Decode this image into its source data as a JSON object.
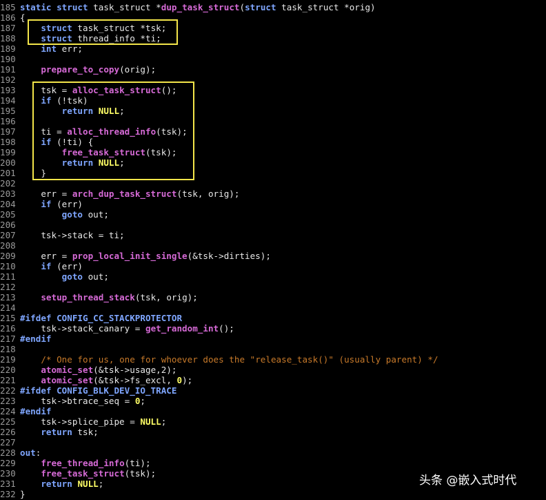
{
  "editor": {
    "lines": [
      {
        "n": "185",
        "tokens": [
          {
            "t": "static",
            "c": "kw"
          },
          {
            "t": " "
          },
          {
            "t": "struct",
            "c": "kw"
          },
          {
            "t": " task_struct *"
          },
          {
            "t": "dup_task_struct",
            "c": "fn"
          },
          {
            "t": "("
          },
          {
            "t": "struct",
            "c": "kw"
          },
          {
            "t": " task_struct *orig)"
          }
        ]
      },
      {
        "n": "186",
        "tokens": [
          {
            "t": "{"
          }
        ]
      },
      {
        "n": "187",
        "tokens": [
          {
            "t": "    "
          },
          {
            "t": "struct",
            "c": "kw"
          },
          {
            "t": " task_struct *tsk;"
          }
        ]
      },
      {
        "n": "188",
        "tokens": [
          {
            "t": "    "
          },
          {
            "t": "struct",
            "c": "kw"
          },
          {
            "t": " thread_info *ti;"
          }
        ]
      },
      {
        "n": "189",
        "tokens": [
          {
            "t": "    "
          },
          {
            "t": "int",
            "c": "kw"
          },
          {
            "t": " err;"
          }
        ]
      },
      {
        "n": "190",
        "tokens": []
      },
      {
        "n": "191",
        "tokens": [
          {
            "t": "    "
          },
          {
            "t": "prepare_to_copy",
            "c": "fn"
          },
          {
            "t": "(orig);"
          }
        ]
      },
      {
        "n": "192",
        "tokens": []
      },
      {
        "n": "193",
        "tokens": [
          {
            "t": "    tsk = "
          },
          {
            "t": "alloc_task_struct",
            "c": "fn"
          },
          {
            "t": "();"
          }
        ]
      },
      {
        "n": "194",
        "tokens": [
          {
            "t": "    "
          },
          {
            "t": "if",
            "c": "kw"
          },
          {
            "t": " (!tsk)"
          }
        ]
      },
      {
        "n": "195",
        "tokens": [
          {
            "t": "        "
          },
          {
            "t": "return",
            "c": "kw"
          },
          {
            "t": " "
          },
          {
            "t": "NULL",
            "c": "ct"
          },
          {
            "t": ";"
          }
        ]
      },
      {
        "n": "196",
        "tokens": []
      },
      {
        "n": "197",
        "tokens": [
          {
            "t": "    ti = "
          },
          {
            "t": "alloc_thread_info",
            "c": "fn"
          },
          {
            "t": "(tsk);"
          }
        ]
      },
      {
        "n": "198",
        "tokens": [
          {
            "t": "    "
          },
          {
            "t": "if",
            "c": "kw"
          },
          {
            "t": " (!ti) {"
          }
        ]
      },
      {
        "n": "199",
        "tokens": [
          {
            "t": "        "
          },
          {
            "t": "free_task_struct",
            "c": "fn"
          },
          {
            "t": "(tsk);"
          }
        ]
      },
      {
        "n": "200",
        "tokens": [
          {
            "t": "        "
          },
          {
            "t": "return",
            "c": "kw"
          },
          {
            "t": " "
          },
          {
            "t": "NULL",
            "c": "ct"
          },
          {
            "t": ";"
          }
        ]
      },
      {
        "n": "201",
        "tokens": [
          {
            "t": "    }"
          }
        ]
      },
      {
        "n": "202",
        "tokens": []
      },
      {
        "n": "203",
        "tokens": [
          {
            "t": "    err = "
          },
          {
            "t": "arch_dup_task_struct",
            "c": "fn"
          },
          {
            "t": "(tsk, orig);"
          }
        ]
      },
      {
        "n": "204",
        "tokens": [
          {
            "t": "    "
          },
          {
            "t": "if",
            "c": "kw"
          },
          {
            "t": " (err)"
          }
        ]
      },
      {
        "n": "205",
        "tokens": [
          {
            "t": "        "
          },
          {
            "t": "goto",
            "c": "kw"
          },
          {
            "t": " out;"
          }
        ]
      },
      {
        "n": "206",
        "tokens": []
      },
      {
        "n": "207",
        "tokens": [
          {
            "t": "    tsk->stack = ti;"
          }
        ]
      },
      {
        "n": "208",
        "tokens": []
      },
      {
        "n": "209",
        "tokens": [
          {
            "t": "    err = "
          },
          {
            "t": "prop_local_init_single",
            "c": "fn"
          },
          {
            "t": "(&tsk->dirties);"
          }
        ]
      },
      {
        "n": "210",
        "tokens": [
          {
            "t": "    "
          },
          {
            "t": "if",
            "c": "kw"
          },
          {
            "t": " (err)"
          }
        ]
      },
      {
        "n": "211",
        "tokens": [
          {
            "t": "        "
          },
          {
            "t": "goto",
            "c": "kw"
          },
          {
            "t": " out;"
          }
        ]
      },
      {
        "n": "212",
        "tokens": []
      },
      {
        "n": "213",
        "tokens": [
          {
            "t": "    "
          },
          {
            "t": "setup_thread_stack",
            "c": "fn"
          },
          {
            "t": "(tsk, orig);"
          }
        ]
      },
      {
        "n": "214",
        "tokens": []
      },
      {
        "n": "215",
        "tokens": [
          {
            "t": "#ifdef CONFIG_CC_STACKPROTECTOR",
            "c": "pp"
          }
        ]
      },
      {
        "n": "216",
        "tokens": [
          {
            "t": "    tsk->stack_canary = "
          },
          {
            "t": "get_random_int",
            "c": "fn"
          },
          {
            "t": "();"
          }
        ]
      },
      {
        "n": "217",
        "tokens": [
          {
            "t": "#endif",
            "c": "pp"
          }
        ]
      },
      {
        "n": "218",
        "tokens": []
      },
      {
        "n": "219",
        "tokens": [
          {
            "t": "    "
          },
          {
            "t": "/* One for us, one for whoever does the \"release_task()\" (usually parent) */",
            "c": "cm"
          }
        ]
      },
      {
        "n": "220",
        "tokens": [
          {
            "t": "    "
          },
          {
            "t": "atomic_set",
            "c": "fn"
          },
          {
            "t": "(&tsk->usage,2);"
          }
        ]
      },
      {
        "n": "221",
        "tokens": [
          {
            "t": "    "
          },
          {
            "t": "atomic_set",
            "c": "fn"
          },
          {
            "t": "(&tsk->fs_excl, "
          },
          {
            "t": "0",
            "c": "ct"
          },
          {
            "t": ");"
          }
        ]
      },
      {
        "n": "222",
        "tokens": [
          {
            "t": "#ifdef CONFIG_BLK_DEV_IO_TRACE",
            "c": "pp"
          }
        ]
      },
      {
        "n": "223",
        "tokens": [
          {
            "t": "    tsk->btrace_seq = "
          },
          {
            "t": "0",
            "c": "ct"
          },
          {
            "t": ";"
          }
        ]
      },
      {
        "n": "224",
        "tokens": [
          {
            "t": "#endif",
            "c": "pp"
          }
        ]
      },
      {
        "n": "225",
        "tokens": [
          {
            "t": "    tsk->splice_pipe = "
          },
          {
            "t": "NULL",
            "c": "ct"
          },
          {
            "t": ";"
          }
        ]
      },
      {
        "n": "226",
        "tokens": [
          {
            "t": "    "
          },
          {
            "t": "return",
            "c": "kw"
          },
          {
            "t": " tsk;"
          }
        ]
      },
      {
        "n": "227",
        "tokens": []
      },
      {
        "n": "228",
        "tokens": [
          {
            "t": "out",
            "c": "kw"
          },
          {
            "t": ":"
          }
        ]
      },
      {
        "n": "229",
        "tokens": [
          {
            "t": "    "
          },
          {
            "t": "free_thread_info",
            "c": "fn"
          },
          {
            "t": "(ti);"
          }
        ]
      },
      {
        "n": "230",
        "tokens": [
          {
            "t": "    "
          },
          {
            "t": "free_task_struct",
            "c": "fn"
          },
          {
            "t": "(tsk);"
          }
        ]
      },
      {
        "n": "231",
        "tokens": [
          {
            "t": "    "
          },
          {
            "t": "return",
            "c": "kw"
          },
          {
            "t": " "
          },
          {
            "t": "NULL",
            "c": "ct"
          },
          {
            "t": ";"
          }
        ]
      },
      {
        "n": "232",
        "tokens": [
          {
            "t": "}"
          }
        ]
      }
    ]
  },
  "watermark": {
    "text": "头条 @嵌入式时代"
  },
  "colors": {
    "highlight_box": "#f4e64a",
    "background": "#000000"
  }
}
